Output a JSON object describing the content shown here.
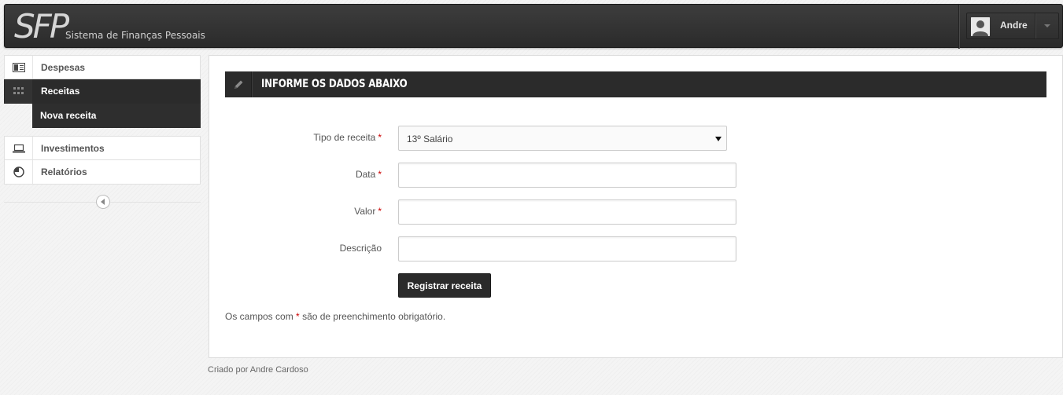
{
  "header": {
    "logo_text": "SFP",
    "brand_subtitle": "Sistema de Finanças Pessoais",
    "user": {
      "name": "Andre",
      "avatar_icon": "user-avatar-icon",
      "caret_icon": "caret-down-icon"
    }
  },
  "sidebar": {
    "items": [
      {
        "label": "Despesas",
        "icon": "list-icon",
        "active": false
      },
      {
        "label": "Receitas",
        "icon": "grid-icon",
        "active": true,
        "submenu": [
          {
            "label": "Nova receita"
          }
        ]
      },
      {
        "label": "Investimentos",
        "icon": "laptop-icon",
        "active": false
      },
      {
        "label": "Relatórios",
        "icon": "pie-chart-icon",
        "active": false
      }
    ],
    "collapse_icon": "chevron-left-icon"
  },
  "form": {
    "title": "Informe os dados abaixo",
    "title_icon": "pencil-icon",
    "required_mark": "*",
    "fields": {
      "tipo": {
        "label": "Tipo de receita",
        "required": true,
        "value": "13º Salário"
      },
      "data": {
        "label": "Data",
        "required": true,
        "value": ""
      },
      "valor": {
        "label": "Valor",
        "required": true,
        "value": ""
      },
      "descricao": {
        "label": "Descrição",
        "required": false,
        "value": ""
      }
    },
    "submit_label": "Registrar receita",
    "note_prefix": "Os campos com",
    "note_suffix": "são de preenchimento obrigatório."
  },
  "footer": {
    "text": "Criado por Andre Cardoso"
  },
  "colors": {
    "dark": "#2b2b2b",
    "required": "#cc0000",
    "background": "#f4f4f4"
  }
}
